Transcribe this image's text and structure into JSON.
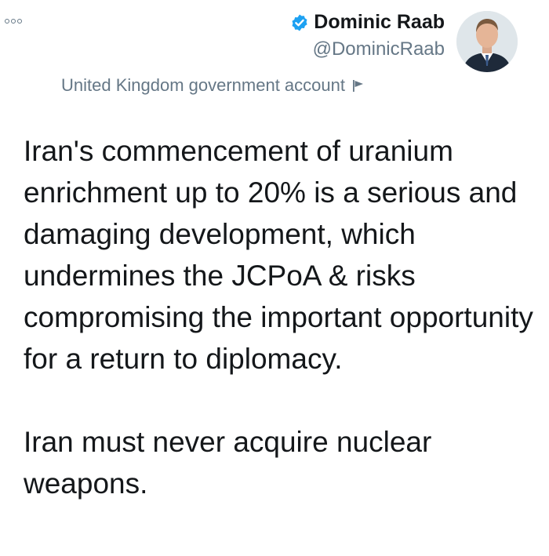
{
  "header": {
    "menu_icon": "more-options-icon",
    "author": {
      "display_name": "Dominic Raab",
      "handle": "@DominicRaab",
      "verified": true,
      "verified_icon": "verified-badge-icon",
      "verified_color": "#1da1f2"
    },
    "avatar_icon": "profile-photo"
  },
  "account_label": {
    "text": "United Kingdom government account",
    "icon": "flag-icon"
  },
  "tweet": {
    "paragraphs": [
      "Iran's commencement of uranium enrichment up to 20% is a serious and damaging development, which undermines the JCPoA & risks compromising the important opportunity for a return to diplomacy.",
      "Iran must never acquire nuclear weapons."
    ]
  }
}
